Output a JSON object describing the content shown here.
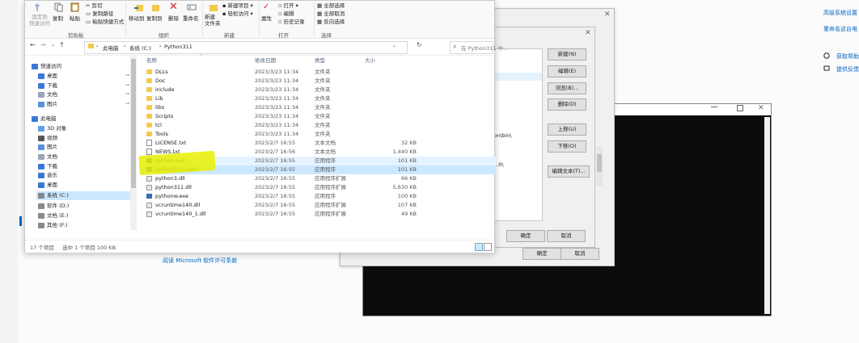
{
  "settings": {
    "links_right": [
      "高级系统设置",
      "重命名这台电"
    ],
    "help_links": [
      "获取帮助",
      "提供反馈"
    ],
    "license_link": "阅读 Microsoft 软件许可条款"
  },
  "ribbon": {
    "pin_label": "固定到\n快速访问",
    "copy_label": "复制",
    "paste_label": "粘贴",
    "cut_label": "剪切",
    "copy_path_label": "复制路径",
    "paste_shortcut_label": "粘贴快捷方式",
    "move_to_label": "移动到",
    "copy_to_label": "复制到",
    "delete_label": "删除",
    "rename_label": "重命名",
    "new_folder_label": "新建\n文件夹",
    "new_item_label": "新建项目",
    "easy_access_label": "轻松访问",
    "properties_label": "属性",
    "open_label": "打开",
    "edit_label": "编辑",
    "history_label": "历史记录",
    "select_all_label": "全部选择",
    "select_none_label": "全部取消",
    "invert_label": "反向选择",
    "groups": [
      "剪贴板",
      "组织",
      "新建",
      "打开",
      "选择"
    ]
  },
  "address": {
    "crumbs": [
      "此电脑",
      "系统 (C:)",
      "Python311"
    ],
    "search_placeholder": "在 Python311 中..."
  },
  "nav": {
    "items": [
      {
        "label": "快速访问",
        "icon": "star-icon"
      },
      {
        "label": "桌面",
        "icon": "desktop-icon"
      },
      {
        "label": "下载",
        "icon": "download-icon"
      },
      {
        "label": "文档",
        "icon": "document-icon"
      },
      {
        "label": "图片",
        "icon": "picture-icon"
      },
      {
        "label": "此电脑",
        "icon": "computer-icon"
      },
      {
        "label": "3D 对象",
        "icon": "cube-icon"
      },
      {
        "label": "视频",
        "icon": "video-icon"
      },
      {
        "label": "图片",
        "icon": "picture-icon"
      },
      {
        "label": "文档",
        "icon": "document-icon"
      },
      {
        "label": "下载",
        "icon": "download-icon"
      },
      {
        "label": "音乐",
        "icon": "music-icon"
      },
      {
        "label": "桌面",
        "icon": "desktop-icon"
      },
      {
        "label": "系统 (C:)",
        "icon": "drive-icon"
      },
      {
        "label": "软件 (D:)",
        "icon": "drive-icon"
      },
      {
        "label": "文档 (E:)",
        "icon": "drive-icon"
      },
      {
        "label": "其他 (F:)",
        "icon": "drive-icon"
      }
    ]
  },
  "columns": {
    "name": "名称",
    "date": "修改日期",
    "type": "类型",
    "size": "大小"
  },
  "files": [
    {
      "name": "DLLs",
      "date": "2023/3/23 11:34",
      "type": "文件夹",
      "size": "",
      "kind": "folder"
    },
    {
      "name": "Doc",
      "date": "2023/3/23 11:34",
      "type": "文件夹",
      "size": "",
      "kind": "folder"
    },
    {
      "name": "include",
      "date": "2023/3/23 11:34",
      "type": "文件夹",
      "size": "",
      "kind": "folder"
    },
    {
      "name": "Lib",
      "date": "2023/3/23 11:34",
      "type": "文件夹",
      "size": "",
      "kind": "folder"
    },
    {
      "name": "libs",
      "date": "2023/3/23 11:34",
      "type": "文件夹",
      "size": "",
      "kind": "folder"
    },
    {
      "name": "Scripts",
      "date": "2023/3/23 11:34",
      "type": "文件夹",
      "size": "",
      "kind": "folder"
    },
    {
      "name": "tcl",
      "date": "2023/3/23 11:34",
      "type": "文件夹",
      "size": "",
      "kind": "folder"
    },
    {
      "name": "Tools",
      "date": "2023/3/23 11:34",
      "type": "文件夹",
      "size": "",
      "kind": "folder"
    },
    {
      "name": "LICENSE.txt",
      "date": "2023/2/7 16:55",
      "type": "文本文档",
      "size": "32 KB",
      "kind": "doc"
    },
    {
      "name": "NEWS.txt",
      "date": "2023/2/7 16:56",
      "type": "文本文档",
      "size": "1,440 KB",
      "kind": "doc"
    },
    {
      "name": "python.exe",
      "date": "2023/2/7 16:55",
      "type": "应用程序",
      "size": "101 KB",
      "kind": "exe"
    },
    {
      "name": "python3.11.exe",
      "date": "2023/2/7 16:55",
      "type": "应用程序",
      "size": "101 KB",
      "kind": "exe"
    },
    {
      "name": "python3.dll",
      "date": "2023/2/7 16:55",
      "type": "应用程序扩展",
      "size": "66 KB",
      "kind": "dll"
    },
    {
      "name": "python311.dll",
      "date": "2023/2/7 16:55",
      "type": "应用程序扩展",
      "size": "5,630 KB",
      "kind": "dll"
    },
    {
      "name": "pythonw.exe",
      "date": "2023/2/7 16:55",
      "type": "应用程序",
      "size": "100 KB",
      "kind": "exe"
    },
    {
      "name": "vcruntime140.dll",
      "date": "2023/2/7 16:55",
      "type": "应用程序扩展",
      "size": "107 KB",
      "kind": "dll"
    },
    {
      "name": "vcruntime140_1.dll",
      "date": "2023/2/7 16:55",
      "type": "应用程序扩展",
      "size": "49 KB",
      "kind": "dll"
    }
  ],
  "status": {
    "count": "17 个项目",
    "selected": "选中 1 个项目 100 KB"
  },
  "envdialog": {
    "new_label": "新建(N)",
    "edit_label": "编辑(E)",
    "browse_label": "浏览(B)...",
    "delete_label": "删除(D)",
    "up_label": "上移(U)",
    "down_label": "下移(O)",
    "edit_text_label": "编辑文本(T)...",
    "ok_label": "确定",
    "cancel_label": "取消",
    "path_fragment_1": "on\\bin\\",
    "path_fragment_2": "1.0\\"
  },
  "sysprops": {
    "ok_label": "确定",
    "cancel_label": "取消"
  }
}
